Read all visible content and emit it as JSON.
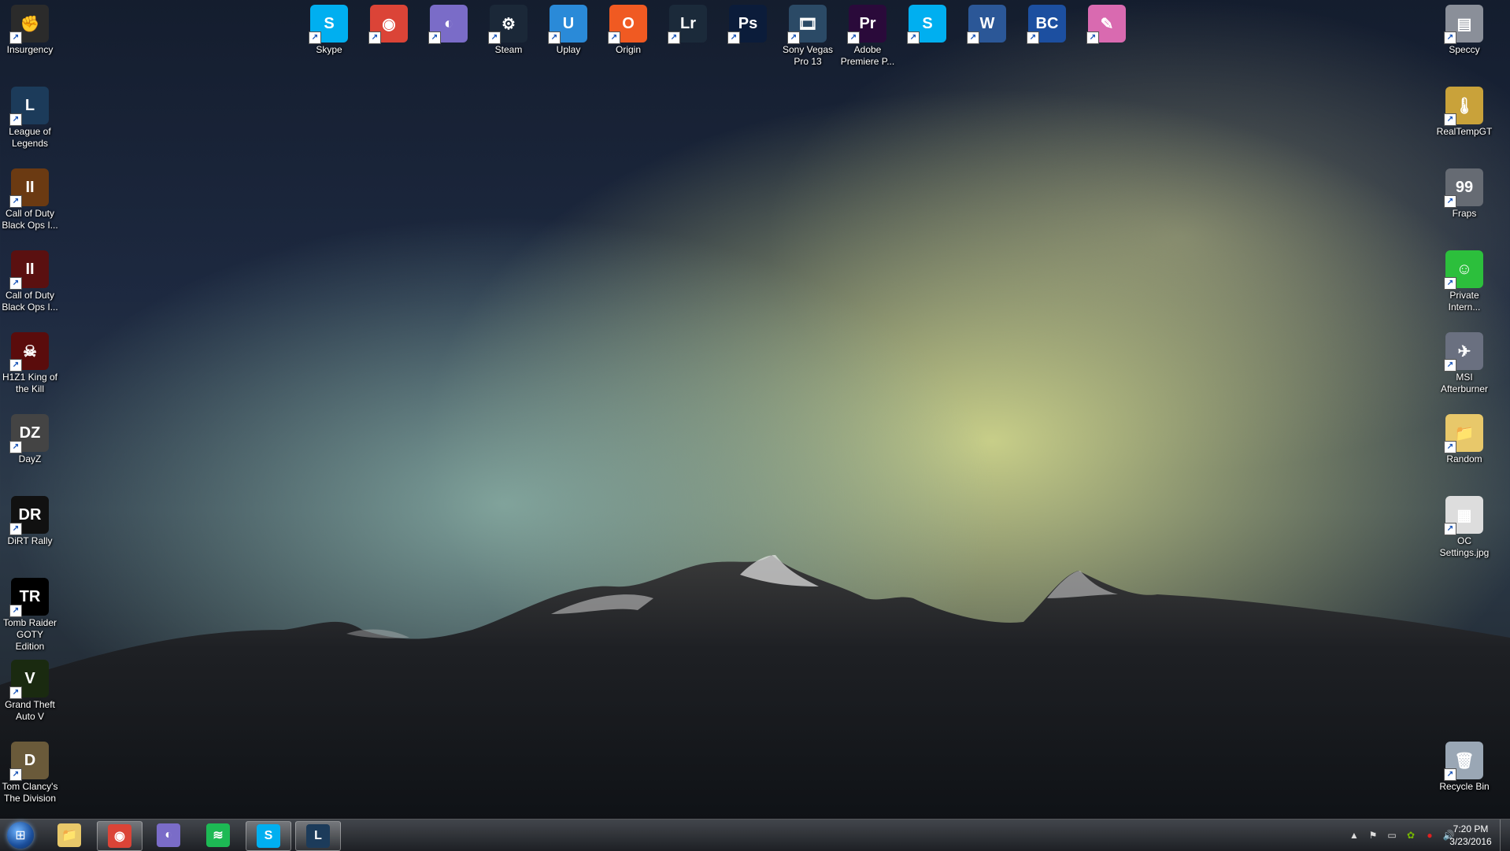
{
  "desktop": {
    "left_column": [
      {
        "label": "Insurgency",
        "icon": "insurgency-icon",
        "color": "#2b2b2b",
        "glyph": "✊"
      },
      {
        "label": "League of Legends",
        "icon": "league-of-legends-icon",
        "color": "#1c3b5a",
        "glyph": "L"
      },
      {
        "label": "Call of Duty Black Ops I...",
        "icon": "call-of-duty-icon",
        "color": "#6b3a12",
        "glyph": "II"
      },
      {
        "label": "Call of Duty Black Ops I...",
        "icon": "call-of-duty-icon",
        "color": "#5a1010",
        "glyph": "II"
      },
      {
        "label": "H1Z1 King of the Kill",
        "icon": "h1z1-icon",
        "color": "#5a0c0c",
        "glyph": "☠"
      },
      {
        "label": "DayZ",
        "icon": "dayz-icon",
        "color": "#444444",
        "glyph": "DZ"
      },
      {
        "label": "DiRT Rally",
        "icon": "dirt-rally-icon",
        "color": "#111111",
        "glyph": "DR"
      },
      {
        "label": "Tomb Raider GOTY Edition",
        "icon": "tomb-raider-icon",
        "color": "#000000",
        "glyph": "TR"
      },
      {
        "label": "Grand Theft Auto V",
        "icon": "gta-v-icon",
        "color": "#1a2a10",
        "glyph": "V"
      },
      {
        "label": "Tom Clancy's The Division",
        "icon": "the-division-icon",
        "color": "#6a5a3a",
        "glyph": "D"
      }
    ],
    "top_row": [
      {
        "label": "Skype",
        "icon": "skype-icon",
        "color": "#00aff0",
        "glyph": "S"
      },
      {
        "label": "",
        "icon": "chrome-icon",
        "color": "#db4437",
        "glyph": "◉"
      },
      {
        "label": "",
        "icon": "bittorrent-icon",
        "color": "#7a6cc8",
        "glyph": "◐"
      },
      {
        "label": "Steam",
        "icon": "steam-icon",
        "color": "#1b2838",
        "glyph": "⚙"
      },
      {
        "label": "Uplay",
        "icon": "uplay-icon",
        "color": "#2a8ad8",
        "glyph": "U"
      },
      {
        "label": "Origin",
        "icon": "origin-icon",
        "color": "#f05a22",
        "glyph": "O"
      },
      {
        "label": "",
        "icon": "lightroom-icon",
        "color": "#1b2a3a",
        "glyph": "Lr"
      },
      {
        "label": "",
        "icon": "photoshop-icon",
        "color": "#0b1c3a",
        "glyph": "Ps"
      },
      {
        "label": "Sony Vegas Pro 13",
        "icon": "sony-vegas-icon",
        "color": "#2b4a66",
        "glyph": "🎞"
      },
      {
        "label": "Adobe Premiere P...",
        "icon": "premiere-icon",
        "color": "#2a0a3a",
        "glyph": "Pr"
      },
      {
        "label": "",
        "icon": "skype-icon",
        "color": "#00aff0",
        "glyph": "S"
      },
      {
        "label": "",
        "icon": "word-icon",
        "color": "#2b5797",
        "glyph": "W"
      },
      {
        "label": "",
        "icon": "beyond-compare-icon",
        "color": "#1c4fa0",
        "glyph": "BC"
      },
      {
        "label": "",
        "icon": "pen-tool-icon",
        "color": "#d96ab0",
        "glyph": "✎"
      }
    ],
    "right_column": [
      {
        "label": "Speccy",
        "icon": "speccy-icon",
        "color": "#8a8f99",
        "glyph": "▤"
      },
      {
        "label": "RealTempGT",
        "icon": "realtemp-icon",
        "color": "#c9a23a",
        "glyph": "🌡"
      },
      {
        "label": "Fraps",
        "icon": "fraps-icon",
        "color": "#666b73",
        "glyph": "99"
      },
      {
        "label": "Private Intern...",
        "icon": "private-internet-access-icon",
        "color": "#2cbf3c",
        "glyph": "☺"
      },
      {
        "label": "MSI Afterburner",
        "icon": "msi-afterburner-icon",
        "color": "#6a7080",
        "glyph": "✈"
      },
      {
        "label": "Random",
        "icon": "folder-icon",
        "color": "#e8c86a",
        "glyph": "📁"
      },
      {
        "label": "OC Settings.jpg",
        "icon": "image-file-icon",
        "color": "#dddddd",
        "glyph": "▦"
      },
      {
        "label": "Recycle Bin",
        "icon": "recycle-bin-icon",
        "color": "#9aa7b5",
        "glyph": "🗑"
      }
    ]
  },
  "taskbar": {
    "start_glyph": "⊞",
    "pinned": [
      {
        "name": "file-explorer",
        "icon": "folder-icon",
        "color": "#e8c86a",
        "glyph": "📁",
        "active": false
      },
      {
        "name": "chrome",
        "icon": "chrome-icon",
        "color": "#db4437",
        "glyph": "◉",
        "active": true
      },
      {
        "name": "bittorrent",
        "icon": "bittorrent-icon",
        "color": "#7a6cc8",
        "glyph": "◐",
        "active": false
      },
      {
        "name": "spotify",
        "icon": "spotify-icon",
        "color": "#1db954",
        "glyph": "≋",
        "active": false
      },
      {
        "name": "skype",
        "icon": "skype-icon",
        "color": "#00aff0",
        "glyph": "S",
        "active": true
      },
      {
        "name": "league-of-legends",
        "icon": "league-of-legends-icon",
        "color": "#1c3b5a",
        "glyph": "L",
        "active": true
      }
    ],
    "tray": [
      {
        "name": "show-hidden-icons",
        "glyph": "▲"
      },
      {
        "name": "action-center-flag-icon",
        "glyph": "⚑"
      },
      {
        "name": "network-icon",
        "glyph": "▭"
      },
      {
        "name": "nvidia-icon",
        "glyph": "✿"
      },
      {
        "name": "antivirus-icon",
        "glyph": "●"
      },
      {
        "name": "volume-icon",
        "glyph": "🔊"
      }
    ],
    "clock": {
      "time": "7:20 PM",
      "date": "3/23/2016"
    }
  }
}
